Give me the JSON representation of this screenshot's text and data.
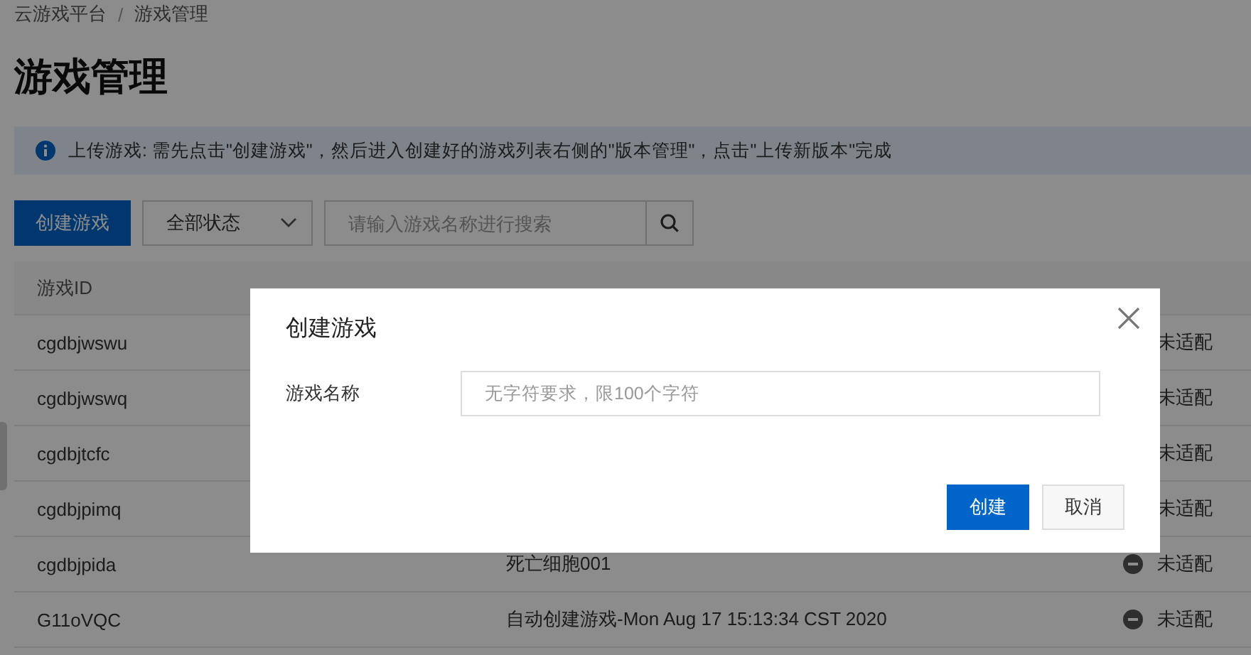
{
  "breadcrumb": [
    "云游戏平台",
    "游戏管理"
  ],
  "breadcrumb_separator": "/",
  "page_title": "游戏管理",
  "notice": "上传游戏: 需先点击\"创建游戏\"，然后进入创建好的游戏列表右侧的\"版本管理\"，点击\"上传新版本\"完成",
  "toolbar": {
    "create_button": "创建游戏",
    "status_filter": "全部状态",
    "search": {
      "placeholder": "请输入游戏名称进行搜索"
    }
  },
  "table": {
    "columns": [
      "游戏ID"
    ],
    "rows": [
      {
        "id": "cgdbjwswu",
        "status": "未适配"
      },
      {
        "id": "cgdbjwswq",
        "status": "未适配"
      },
      {
        "id": "cgdbjtcfc",
        "status": "未适配"
      },
      {
        "id": "cgdbjpimq",
        "status": "未适配"
      },
      {
        "id": "cgdbjpida",
        "name": "死亡细胞001",
        "status": "未适配",
        "status_icon": true
      },
      {
        "id": "G11oVQC",
        "name": "自动创建游戏-Mon Aug 17 15:13:34 CST 2020",
        "status": "未适配",
        "status_icon": true
      }
    ]
  },
  "dialog": {
    "title": "创建游戏",
    "field_label": "游戏名称",
    "field_placeholder": "无字符要求，限100个字符",
    "confirm": "创建",
    "cancel": "取消"
  }
}
